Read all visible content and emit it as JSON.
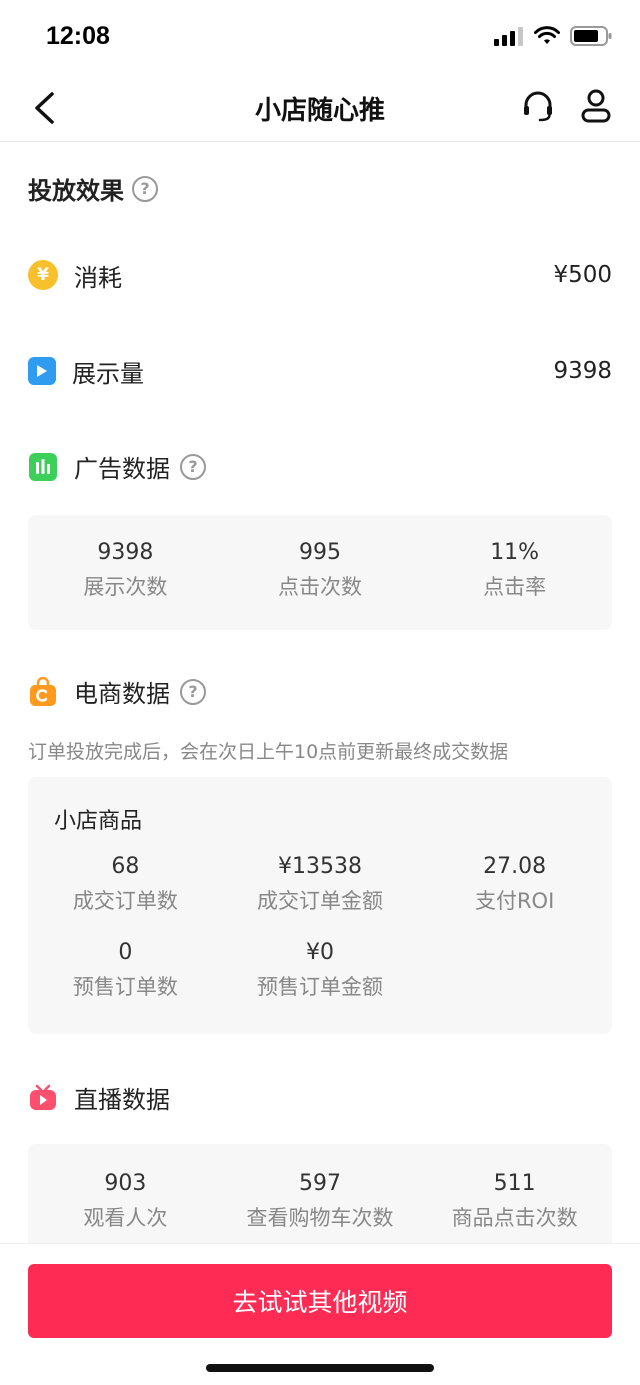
{
  "status_bar": {
    "time": "12:08"
  },
  "nav": {
    "title": "小店随心推"
  },
  "effect": {
    "title": "投放效果",
    "help_glyph": "?",
    "consume": {
      "label": "消耗",
      "value": "¥500",
      "icon_glyph": "¥"
    },
    "impressions": {
      "label": "展示量",
      "value": "9398"
    }
  },
  "ad_data": {
    "title": "广告数据",
    "stats": [
      {
        "value": "9398",
        "label": "展示次数"
      },
      {
        "value": "995",
        "label": "点击次数"
      },
      {
        "value": "11%",
        "label": "点击率"
      }
    ]
  },
  "ecom_data": {
    "title": "电商数据",
    "note": "订单投放完成后，会在次日上午10点前更新最终成交数据",
    "card_title": "小店商品",
    "row1": [
      {
        "value": "68",
        "label": "成交订单数"
      },
      {
        "value": "¥13538",
        "label": "成交订单金额"
      },
      {
        "value": "27.08",
        "label": "支付ROI"
      }
    ],
    "row2": [
      {
        "value": "0",
        "label": "预售订单数"
      },
      {
        "value": "¥0",
        "label": "预售订单金额"
      }
    ]
  },
  "live_data": {
    "title": "直播数据",
    "stats": [
      {
        "value": "903",
        "label": "观看人次"
      },
      {
        "value": "597",
        "label": "查看购物车次数"
      },
      {
        "value": "511",
        "label": "商品点击次数"
      }
    ]
  },
  "cta": {
    "label": "去试试其他视频"
  },
  "colors": {
    "accent": "#fe2c55",
    "coin": "#f7c02c",
    "play": "#2f9cf0",
    "chart": "#3ccf5a",
    "shop": "#ff9a1f",
    "tv": "#ff4f6f"
  }
}
